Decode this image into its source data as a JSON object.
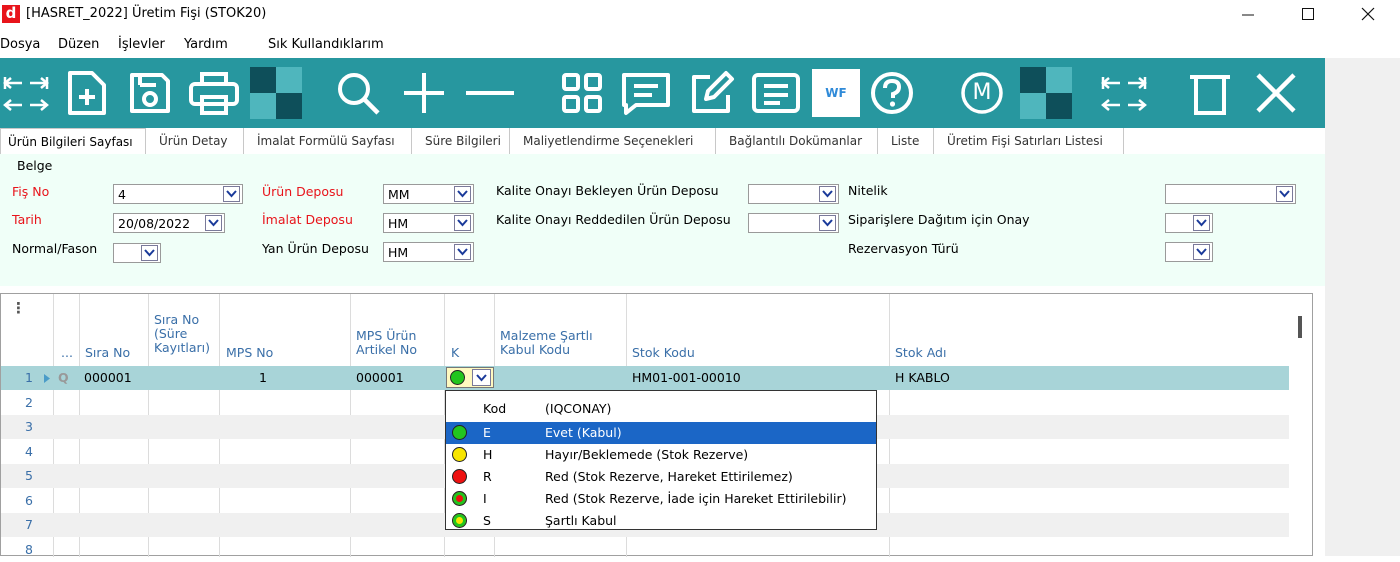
{
  "window": {
    "app_icon_letter": "d",
    "title": "[HASRET_2022] Üretim Fişi (STOK20)"
  },
  "menu": [
    "Dosya",
    "Düzen",
    "İşlevler",
    "Yardım",
    "Sık Kullandıklarım"
  ],
  "toolbar": {
    "background": "#27979f",
    "wf_label": "WF",
    "m_label": "M"
  },
  "tabs": [
    "Ürün Bilgileri Sayfası",
    "Ürün Detay",
    "İmalat Formülü Sayfası",
    "Süre Bilgileri",
    "Maliyetlendirme Seçenekleri",
    "Bağlantılı Dokümanlar",
    "Liste",
    "Üretim Fişi Satırları Listesi"
  ],
  "form": {
    "section_label": "Belge",
    "fis_no": {
      "label": "Fiş No",
      "value": "4"
    },
    "tarih": {
      "label": "Tarih",
      "value": "20/08/2022"
    },
    "normal_fason": {
      "label": "Normal/Fason",
      "value": ""
    },
    "urun_deposu": {
      "label": "Ürün Deposu",
      "value": "MM"
    },
    "imalat_deposu": {
      "label": "İmalat Deposu",
      "value": "HM"
    },
    "yan_urun_deposu": {
      "label": "Yan Ürün Deposu",
      "value": "HM"
    },
    "kalite_bekleyen": {
      "label": "Kalite Onayı Bekleyen Ürün Deposu",
      "value": ""
    },
    "kalite_reddedilen": {
      "label": "Kalite Onayı Reddedilen Ürün Deposu",
      "value": ""
    },
    "nitelik": {
      "label": "Nitelik",
      "value": ""
    },
    "siparis_onay": {
      "label": "Siparişlere Dağıtım için Onay",
      "value": ""
    },
    "rezervasyon": {
      "label": "Rezervasyon Türü",
      "value": ""
    }
  },
  "grid": {
    "menu_glyph": "⋮",
    "headers": {
      "dots": "...",
      "sira_no": "Sıra No",
      "sira_no_sure": [
        "Sıra No",
        "(Süre",
        "Kayıtları)"
      ],
      "mps_no": "MPS No",
      "mps_urun": [
        "MPS Ürün",
        "Artikel No"
      ],
      "k": "K",
      "malzeme": [
        "Malzeme Şartlı",
        "Kabul Kodu"
      ],
      "stok_kodu": "Stok Kodu",
      "stok_adi": "Stok Adı"
    },
    "row_numbers": [
      "1",
      "2",
      "3",
      "4",
      "5",
      "6",
      "7",
      "8"
    ],
    "row1": {
      "lookup_glyph": "Q",
      "sira_no": "000001",
      "mps_no": "1",
      "mps_urun": "000001",
      "stok_kodu": "HM01-001-00010",
      "stok_adi": "H KABLO"
    }
  },
  "popup": {
    "header_kod": "Kod",
    "header_desc": "(IQCONAY)",
    "items": [
      {
        "kod": "E",
        "desc": "Evet (Kabul)",
        "color": "#22c51e"
      },
      {
        "kod": "H",
        "desc": "Hayır/Beklemede (Stok Rezerve)",
        "color": "#f7e500"
      },
      {
        "kod": "R",
        "desc": "Red (Stok Rezerve, Hareket Ettirilemez)",
        "color": "#ee1111"
      },
      {
        "kod": "I",
        "desc": "Red (Stok Rezerve, İade için Hareket Ettirilebilir)",
        "color": "#ee1111"
      },
      {
        "kod": "S",
        "desc": "Şartlı Kabul",
        "color": "#f7e500"
      }
    ]
  }
}
